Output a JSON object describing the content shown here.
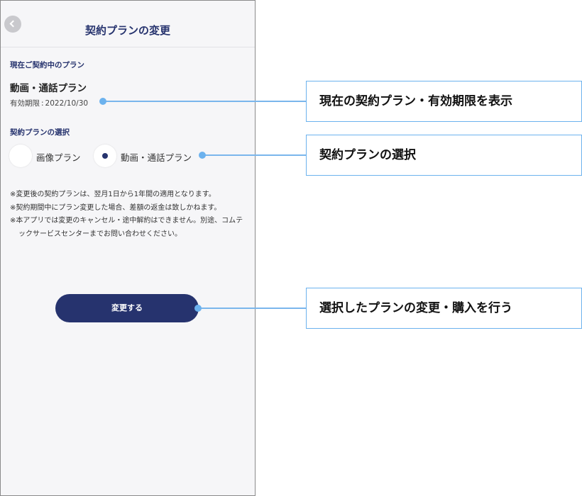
{
  "header": {
    "title": "契約プランの変更",
    "back_icon": "chevron-left-icon"
  },
  "current_plan": {
    "section_label": "現在ご契約中のプラン",
    "plan_name": "動画・通話プラン",
    "expiry_label": "有効期限",
    "expiry_separator": ":",
    "expiry_date": "2022/10/30"
  },
  "plan_selection": {
    "section_label": "契約プランの選択",
    "options": [
      {
        "label": "画像プラン",
        "selected": false
      },
      {
        "label": "動画・通話プラン",
        "selected": true
      }
    ]
  },
  "notes": [
    "※変更後の契約プランは、翌月1日から1年間の適用となります。",
    "※契約期間中にプラン変更した場合、差額の返金は致しかねます。",
    "※本アプリでは変更のキャンセル・途中解約はできません。別途、コムテックサービスセンターまでお問い合わせください。"
  ],
  "submit_button": {
    "label": "変更する"
  },
  "callouts": [
    "現在の契約プラン・有効期限を表示",
    "契約プランの選択",
    "選択したプランの変更・購入を行う"
  ],
  "colors": {
    "accent": "#26336e",
    "callout_border": "#6cb2ee",
    "background": "#f6f6f8"
  }
}
